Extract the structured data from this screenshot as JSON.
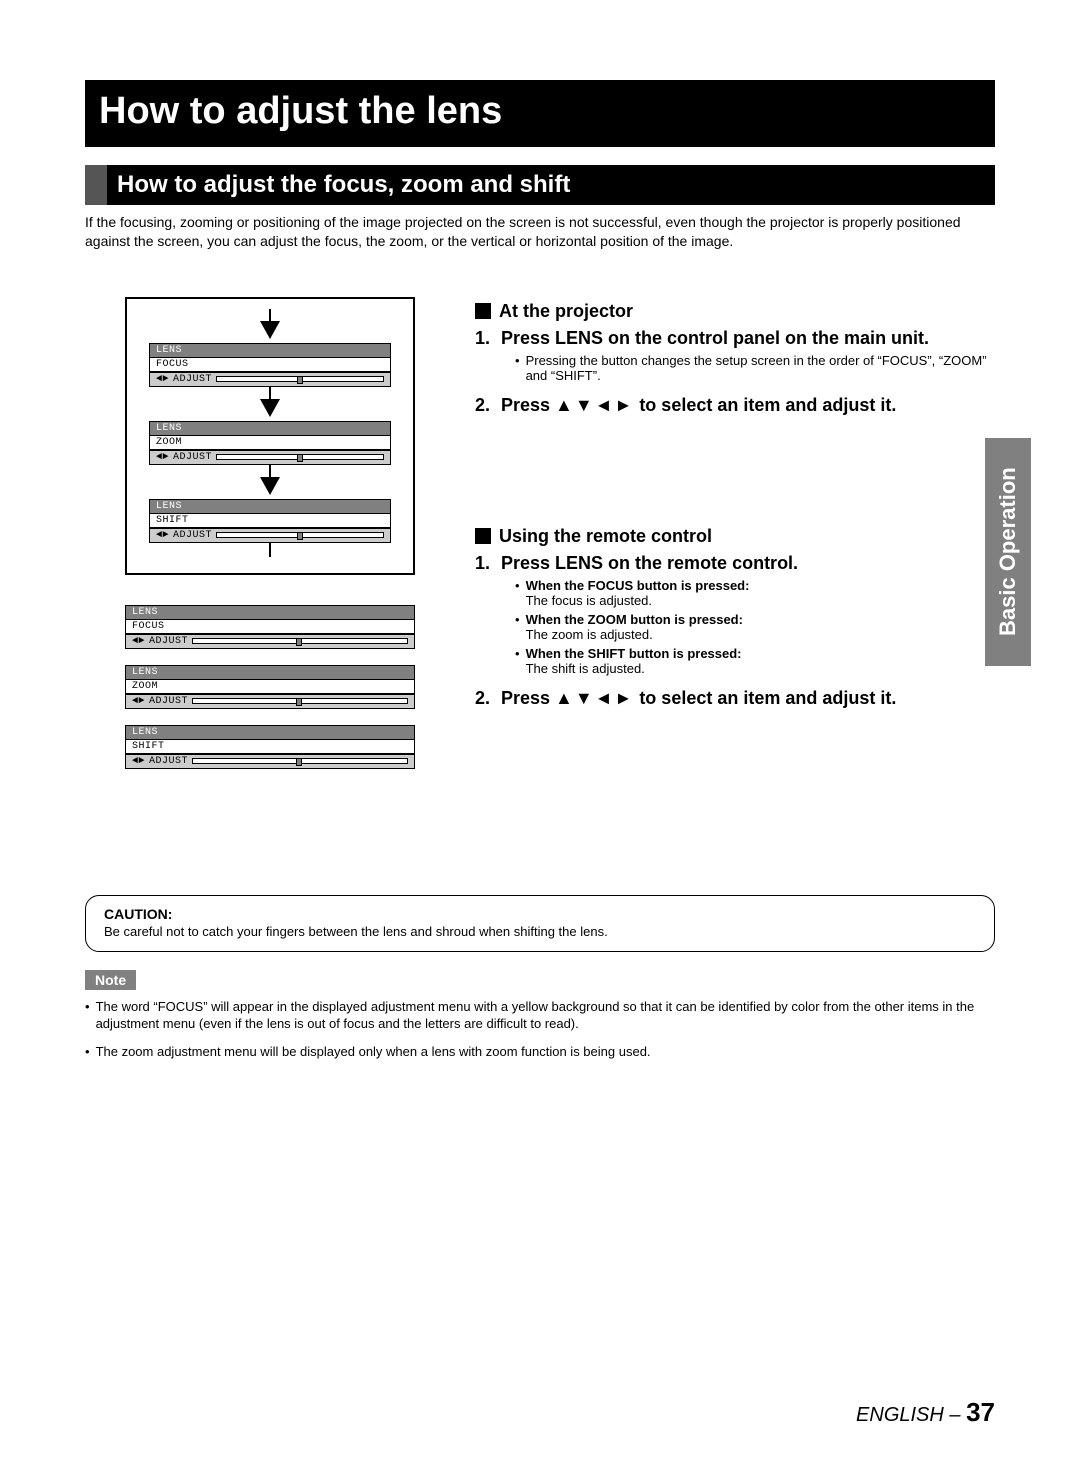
{
  "page_title": "How to adjust the lens",
  "section_title": "How to adjust the focus, zoom and shift",
  "intro": "If the focusing, zooming or positioning of the image projected on the screen is not successful, even though the projector is properly positioned against the screen, you can adjust the focus, the zoom, or the vertical or horizontal position of the image.",
  "menus": {
    "header": "LENS",
    "focus": "FOCUS",
    "zoom": "ZOOM",
    "shift": "SHIFT",
    "adjust": "ADJUST"
  },
  "right": {
    "at_projector": "At the projector",
    "step1a": "Press LENS on the control panel on the main unit.",
    "step1a_sub": "Pressing the button changes the setup screen in the order of “FOCUS”, “ZOOM” and “SHIFT”.",
    "step2a_pre": "Press ",
    "step2a_arrows": "▲▼◄►",
    "step2a_post": " to select an item and adjust it.",
    "using_remote": "Using the remote control",
    "step1b": "Press LENS on the remote control.",
    "step1b_sub_focus_bold": "When the FOCUS button is pressed:",
    "step1b_sub_focus": "The focus is adjusted.",
    "step1b_sub_zoom_bold": "When the ZOOM button is pressed:",
    "step1b_sub_zoom": "The zoom is adjusted.",
    "step1b_sub_shift_bold": "When the SHIFT button is pressed:",
    "step1b_sub_shift": "The shift is adjusted.",
    "step2b_pre": "Press ",
    "step2b_arrows": "▲▼◄►",
    "step2b_post": " to select an item and adjust it."
  },
  "caution": {
    "label": "CAUTION:",
    "text": "Be careful not to catch your fingers between the lens and shroud when shifting the lens."
  },
  "note": {
    "label": "Note",
    "n1": "The word “FOCUS” will appear in the displayed adjustment menu with a yellow background so that it can be identified by color from the other items in the adjustment menu (even if the lens is out of focus and the letters are difficult to read).",
    "n2": "The zoom adjustment menu will be displayed only when a lens with zoom function is being used."
  },
  "side_tab": "Basic Operation",
  "footer": {
    "lang": "ENGLISH – ",
    "page": "37"
  }
}
